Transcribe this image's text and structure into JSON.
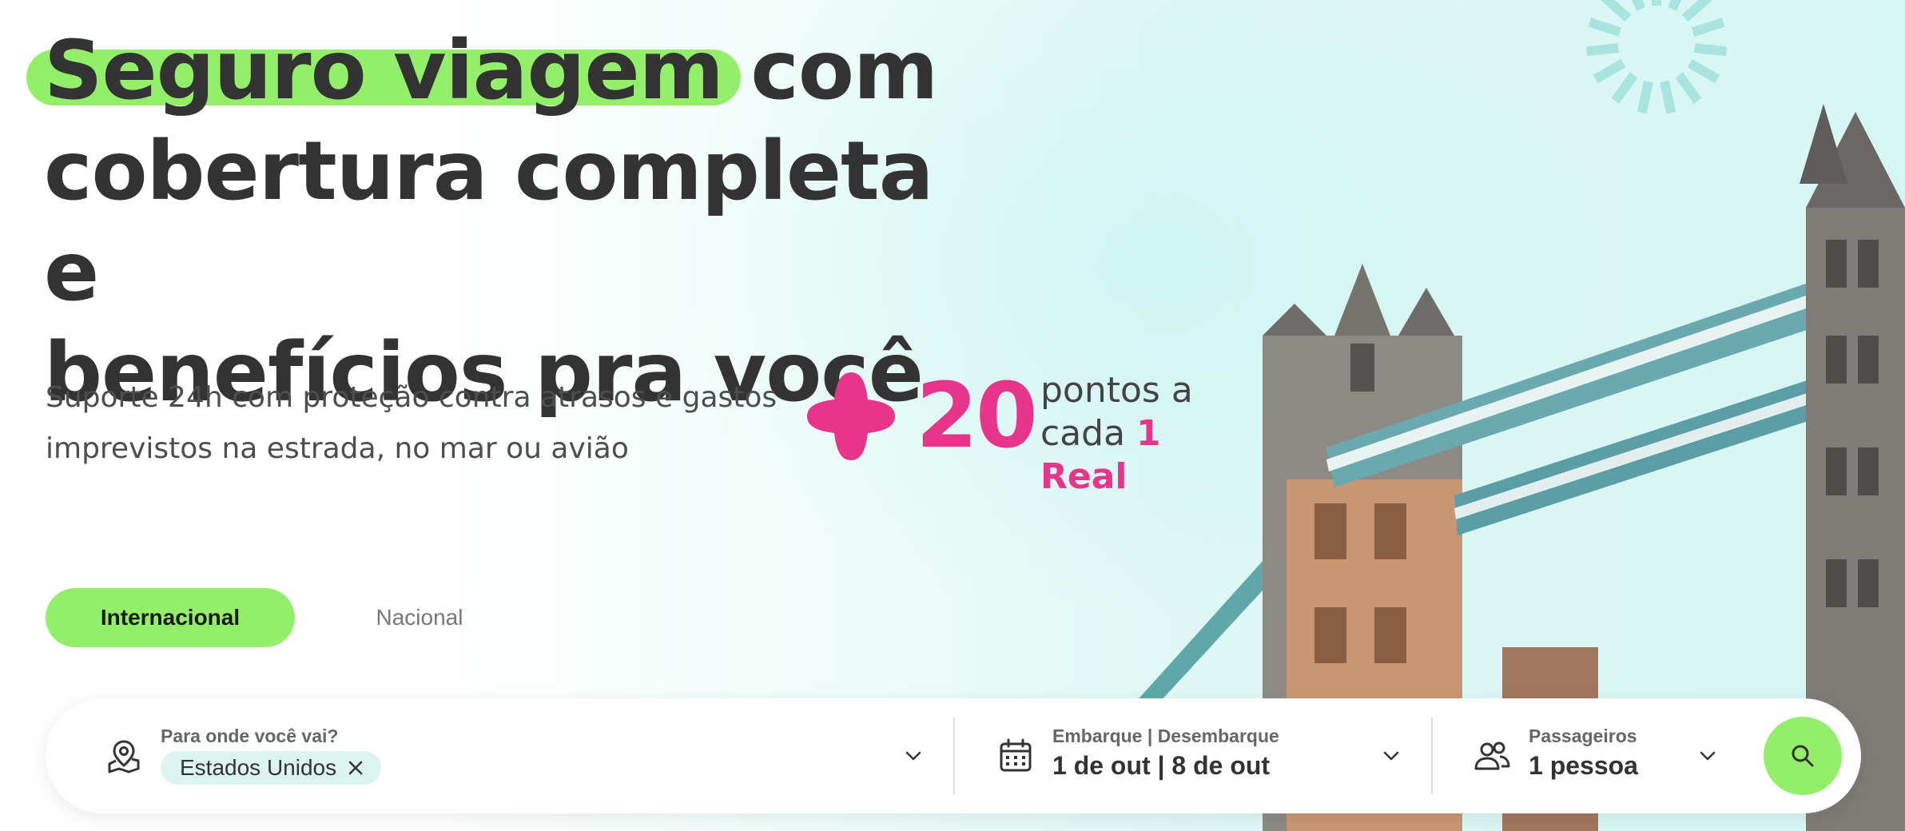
{
  "hero": {
    "title_highlight": "Seguro viagem",
    "title_rest_line1": " com",
    "title_line2": "cobertura completa e",
    "title_line3": "benefícios pra você",
    "subtitle_line1": "Suporte 24h com proteção contra atrasos e gastos",
    "subtitle_line2": "imprevistos na estrada, no mar ou avião"
  },
  "promo": {
    "points_value": "20",
    "points_line1": "pontos a",
    "points_line2_prefix": "cada ",
    "points_line2_highlight": "1 Real",
    "icon": "plus-shape-icon"
  },
  "tabs": [
    {
      "label": "Internacional",
      "active": true
    },
    {
      "label": "Nacional",
      "active": false
    }
  ],
  "search": {
    "destination": {
      "label": "Para onde você vai?",
      "chip": "Estados Unidos",
      "icon": "map-pin-icon"
    },
    "dates": {
      "label": "Embarque | Desembarque",
      "value": "1 de out | 8 de out",
      "icon": "calendar-icon"
    },
    "passengers": {
      "label": "Passageiros",
      "value": "1 pessoa",
      "icon": "users-icon"
    }
  },
  "colors": {
    "accent_green": "#93ee6a",
    "accent_pink": "#e8358c",
    "text_dark": "#333333"
  }
}
